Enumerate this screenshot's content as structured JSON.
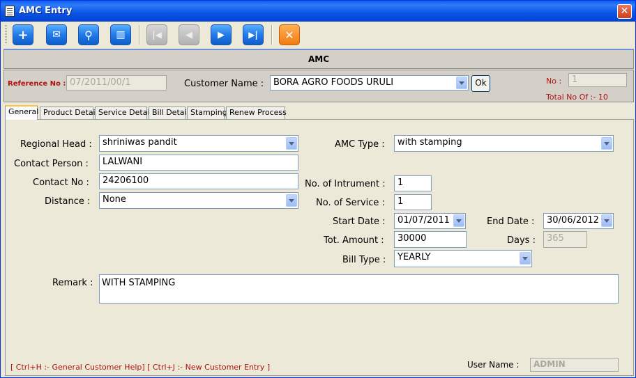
{
  "window": {
    "title": "AMC Entry",
    "close_icon": "close-icon"
  },
  "toolbar": {
    "buttons": [
      {
        "name": "add-button",
        "icon": "plus-icon",
        "glyph": "+"
      },
      {
        "name": "mail-button",
        "icon": "envelope-icon",
        "glyph": "✉"
      },
      {
        "name": "search-button",
        "icon": "magnifier-icon",
        "glyph": "⚲"
      },
      {
        "name": "delete-button",
        "icon": "trash-icon",
        "glyph": "🗑"
      },
      {
        "name": "first-button",
        "icon": "first-record-icon",
        "glyph": "⏮"
      },
      {
        "name": "prev-button",
        "icon": "previous-icon",
        "glyph": "◀"
      },
      {
        "name": "next-button",
        "icon": "next-icon",
        "glyph": "▶"
      },
      {
        "name": "last-button",
        "icon": "last-record-icon",
        "glyph": "⏭"
      },
      {
        "name": "exit-button",
        "icon": "x-icon",
        "glyph": "✕"
      }
    ]
  },
  "header": {
    "title": "AMC"
  },
  "info": {
    "reference_label": "Reference No :",
    "reference_value": "07/2011/00/1",
    "customer_label": "Customer Name :",
    "customer_value": "BORA AGRO FOODS URULI",
    "ok_label": "Ok",
    "no_label": "No :",
    "no_value": "1",
    "total_label": "Total No Of :- 10"
  },
  "tabs": [
    "General",
    "Product Detail",
    "Service Detail",
    "Bill Detail",
    "Stamping",
    "Renew Process"
  ],
  "form": {
    "regional_head_label": "Regional Head :",
    "regional_head_value": "shriniwas pandit",
    "contact_person_label": "Contact Person :",
    "contact_person_value": "LALWANI",
    "contact_no_label": "Contact No :",
    "contact_no_value": "24206100",
    "distance_label": "Distance :",
    "distance_value": "None",
    "amc_type_label": "AMC Type :",
    "amc_type_value": "with stamping",
    "instrument_label": "No. of Intrument :",
    "instrument_value": "1",
    "service_label": "No. of Service :",
    "service_value": "1",
    "start_date_label": "Start Date :",
    "start_date_value": "01/07/2011",
    "end_date_label": "End Date :",
    "end_date_value": "30/06/2012",
    "amount_label": "Tot. Amount :",
    "amount_value": "30000",
    "days_label": "Days :",
    "days_value": "365",
    "bill_type_label": "Bill Type :",
    "bill_type_value": "YEARLY",
    "remark_label": "Remark :",
    "remark_value": "WITH STAMPING"
  },
  "footer": {
    "help_text": "[ Ctrl+H :- General Customer Help] [ Ctrl+J :- New Customer Entry ]",
    "user_label": "User Name :",
    "user_value": "ADMIN"
  }
}
